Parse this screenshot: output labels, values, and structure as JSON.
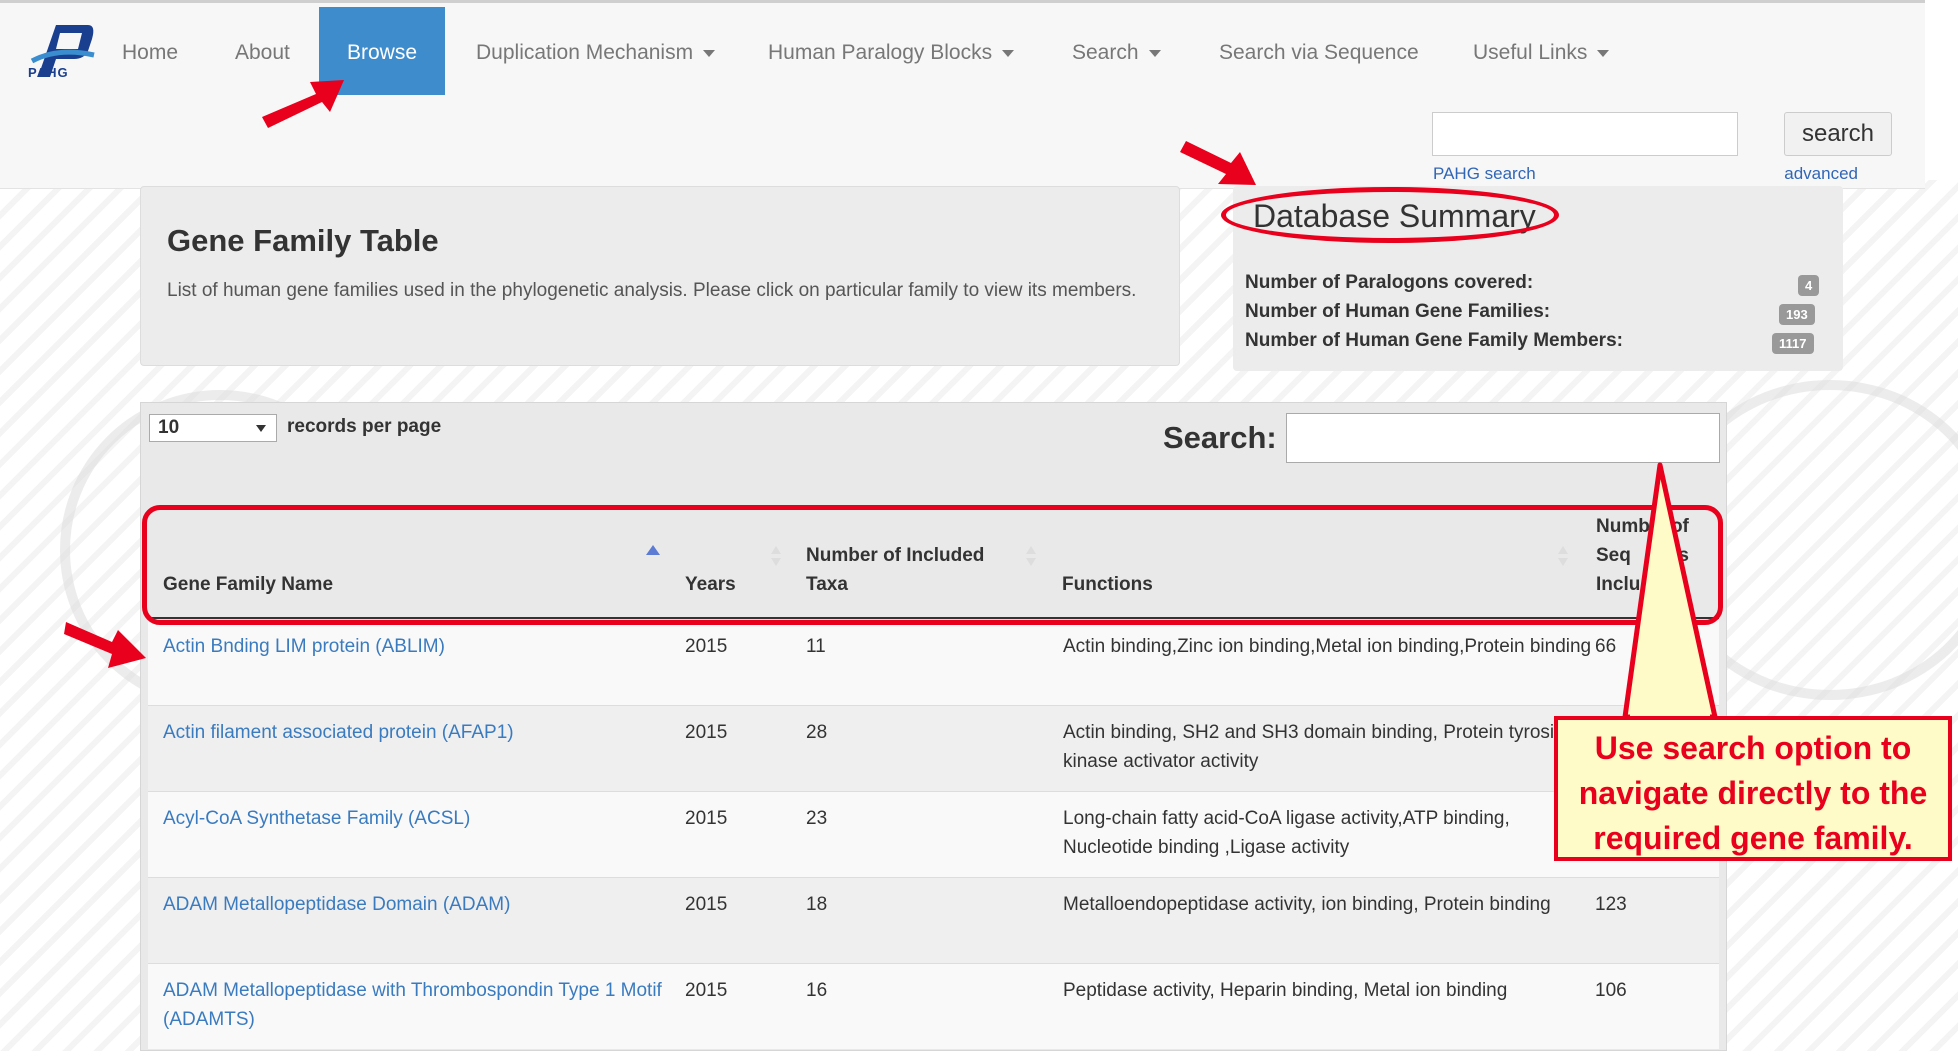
{
  "nav": {
    "logo_text": "PAHG",
    "items": [
      {
        "label": "Home",
        "dropdown": false
      },
      {
        "label": "About",
        "dropdown": false
      },
      {
        "label": "Browse",
        "dropdown": false,
        "active": true
      },
      {
        "label": "Duplication Mechanism",
        "dropdown": true
      },
      {
        "label": "Human Paralogy Blocks",
        "dropdown": true
      },
      {
        "label": "Search",
        "dropdown": true
      },
      {
        "label": "Search via Sequence",
        "dropdown": false
      },
      {
        "label": "Useful Links",
        "dropdown": true
      }
    ],
    "search_button": "search",
    "search_value": "",
    "search_hint": "PAHG search",
    "advanced_link": "advanced"
  },
  "gene_family": {
    "title": "Gene Family Table",
    "description": "List of human gene families used in the phylogenetic analysis. Please click on particular family to view its members."
  },
  "summary": {
    "title": "Database Summary",
    "rows": [
      {
        "label": "Number of Paralogons covered:",
        "value": "4"
      },
      {
        "label": "Number of Human Gene Families:",
        "value": "193"
      },
      {
        "label": "Number of Human Gene Family Members:",
        "value": "1117"
      }
    ]
  },
  "table": {
    "records_per_page": "10",
    "records_label": "records per page",
    "search_label": "Search:",
    "search_value": "",
    "headers": [
      "Gene Family Name",
      "Years",
      "Number of Included Taxa",
      "Functions",
      "Number of Sequences Included"
    ],
    "header_visible": {
      "seq_line1": "Numb    of",
      "seq_line2": "Seq       es",
      "seq_line3": "Inclu"
    },
    "rows": [
      {
        "name": "Actin Bnding LIM protein (ABLIM)",
        "year": "2015",
        "taxa": "11",
        "functions": "Actin binding,Zinc ion binding,Metal ion binding,Protein binding",
        "sequences": "66"
      },
      {
        "name": "Actin filament associated protein (AFAP1)",
        "year": "2015",
        "taxa": "28",
        "functions": "Actin binding, SH2 and SH3 domain binding, Protein tyrosine kinase activator activity",
        "sequences": ""
      },
      {
        "name": "Acyl-CoA Synthetase Family (ACSL)",
        "year": "2015",
        "taxa": "23",
        "functions": "Long-chain fatty acid-CoA ligase activity,ATP binding, Nucleotide binding ,Ligase activity",
        "sequences": ""
      },
      {
        "name": "ADAM Metallopeptidase Domain (ADAM)",
        "year": "2015",
        "taxa": "18",
        "functions": "Metalloendopeptidase activity, ion binding, Protein binding",
        "sequences": "123"
      },
      {
        "name": "ADAM Metallopeptidase with Thrombospondin Type 1 Motif (ADAMTS)",
        "year": "2015",
        "taxa": "16",
        "functions": "Peptidase activity, Heparin binding, Metal ion binding",
        "sequences": "106"
      }
    ]
  },
  "annotation": {
    "callout_line1": "Use search option to",
    "callout_line2": "navigate directly to the",
    "callout_line3": "required gene family.",
    "color": "#e8001c",
    "callout_bg": "#fffbc8"
  },
  "colors": {
    "nav_active": "#3f8ccc",
    "link": "#3a7bbf"
  }
}
